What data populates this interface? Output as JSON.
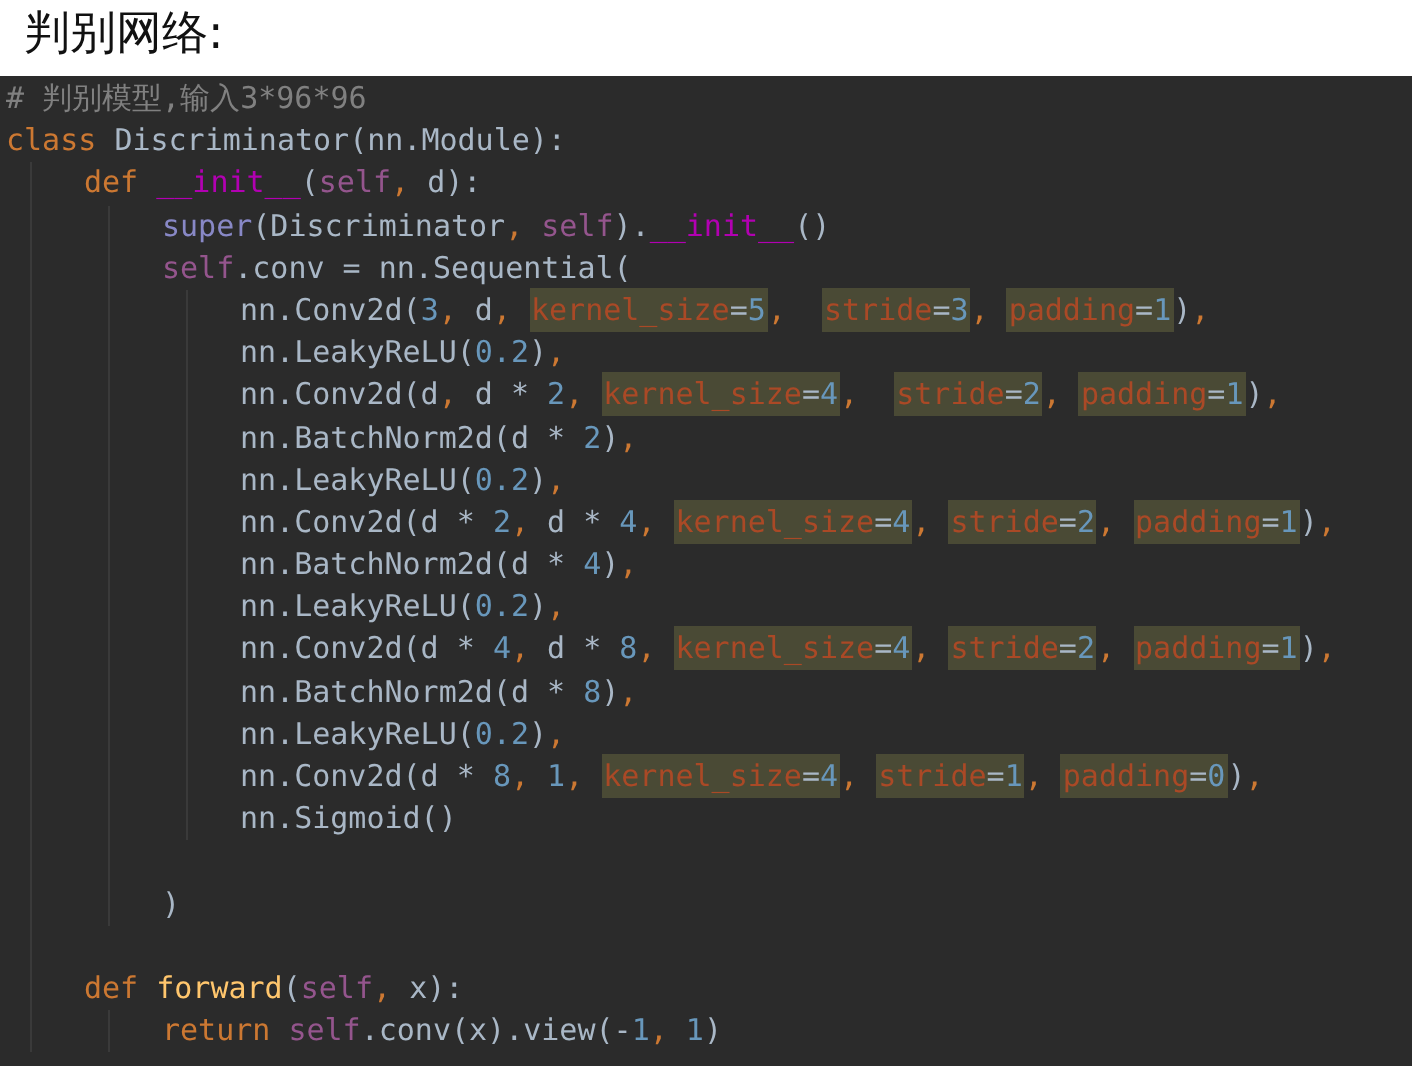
{
  "heading": "判别网络:",
  "code": [
    {
      "tokens": [
        {
          "kind": "cm",
          "t": "# 判别模型,输入3*96*96"
        }
      ]
    },
    {
      "tokens": [
        {
          "kind": "kw",
          "t": "class "
        },
        {
          "kind": "p",
          "t": "Discriminator(nn.Module):"
        }
      ],
      "children": [
        {
          "tokens": [
            {
              "kind": "kw",
              "t": "def "
            },
            {
              "kind": "dunder",
              "t": "__init__"
            },
            {
              "kind": "p",
              "t": "("
            },
            {
              "kind": "self",
              "t": "self"
            },
            {
              "kind": "kw",
              "t": ", "
            },
            {
              "kind": "p",
              "t": "d):"
            }
          ],
          "children": [
            {
              "tokens": [
                {
                  "kind": "builtin",
                  "t": "super"
                },
                {
                  "kind": "p",
                  "t": "(Discriminator"
                },
                {
                  "kind": "kw",
                  "t": ", "
                },
                {
                  "kind": "self",
                  "t": "self"
                },
                {
                  "kind": "p",
                  "t": ")."
                },
                {
                  "kind": "dunder",
                  "t": "__init__"
                },
                {
                  "kind": "p",
                  "t": "()"
                }
              ]
            },
            {
              "tokens": [
                {
                  "kind": "self",
                  "t": "self"
                },
                {
                  "kind": "p",
                  "t": ".conv = nn.Sequential("
                }
              ],
              "children": [
                {
                  "tokens": [
                    {
                      "kind": "p",
                      "t": "nn.Conv2d("
                    },
                    {
                      "kind": "num",
                      "t": "3"
                    },
                    {
                      "kind": "kw",
                      "t": ", "
                    },
                    {
                      "kind": "p",
                      "t": "d"
                    },
                    {
                      "kind": "kw",
                      "t": ", "
                    },
                    {
                      "kind": "hl",
                      "t": "kernel_size",
                      "eq": "=",
                      "v": "5"
                    },
                    {
                      "kind": "kw",
                      "t": ",  "
                    },
                    {
                      "kind": "hl",
                      "t": "stride",
                      "eq": "=",
                      "v": "3"
                    },
                    {
                      "kind": "kw",
                      "t": ", "
                    },
                    {
                      "kind": "hl",
                      "t": "padding",
                      "eq": "=",
                      "v": "1"
                    },
                    {
                      "kind": "p",
                      "t": ")"
                    },
                    {
                      "kind": "kw",
                      "t": ","
                    }
                  ]
                },
                {
                  "tokens": [
                    {
                      "kind": "p",
                      "t": "nn.LeakyReLU("
                    },
                    {
                      "kind": "num",
                      "t": "0.2"
                    },
                    {
                      "kind": "p",
                      "t": ")"
                    },
                    {
                      "kind": "kw",
                      "t": ","
                    }
                  ]
                },
                {
                  "tokens": [
                    {
                      "kind": "p",
                      "t": "nn.Conv2d(d"
                    },
                    {
                      "kind": "kw",
                      "t": ", "
                    },
                    {
                      "kind": "p",
                      "t": "d * "
                    },
                    {
                      "kind": "num",
                      "t": "2"
                    },
                    {
                      "kind": "kw",
                      "t": ", "
                    },
                    {
                      "kind": "hl",
                      "t": "kernel_size",
                      "eq": "=",
                      "v": "4"
                    },
                    {
                      "kind": "kw",
                      "t": ",  "
                    },
                    {
                      "kind": "hl",
                      "t": "stride",
                      "eq": "=",
                      "v": "2"
                    },
                    {
                      "kind": "kw",
                      "t": ", "
                    },
                    {
                      "kind": "hl",
                      "t": "padding",
                      "eq": "=",
                      "v": "1"
                    },
                    {
                      "kind": "p",
                      "t": ")"
                    },
                    {
                      "kind": "kw",
                      "t": ","
                    }
                  ]
                },
                {
                  "tokens": [
                    {
                      "kind": "p",
                      "t": "nn.BatchNorm2d(d * "
                    },
                    {
                      "kind": "num",
                      "t": "2"
                    },
                    {
                      "kind": "p",
                      "t": ")"
                    },
                    {
                      "kind": "kw",
                      "t": ","
                    }
                  ]
                },
                {
                  "tokens": [
                    {
                      "kind": "p",
                      "t": "nn.LeakyReLU("
                    },
                    {
                      "kind": "num",
                      "t": "0.2"
                    },
                    {
                      "kind": "p",
                      "t": ")"
                    },
                    {
                      "kind": "kw",
                      "t": ","
                    }
                  ]
                },
                {
                  "tokens": [
                    {
                      "kind": "p",
                      "t": "nn.Conv2d(d * "
                    },
                    {
                      "kind": "num",
                      "t": "2"
                    },
                    {
                      "kind": "kw",
                      "t": ", "
                    },
                    {
                      "kind": "p",
                      "t": "d * "
                    },
                    {
                      "kind": "num",
                      "t": "4"
                    },
                    {
                      "kind": "kw",
                      "t": ", "
                    },
                    {
                      "kind": "hl",
                      "t": "kernel_size",
                      "eq": "=",
                      "v": "4"
                    },
                    {
                      "kind": "kw",
                      "t": ", "
                    },
                    {
                      "kind": "hl",
                      "t": "stride",
                      "eq": "=",
                      "v": "2"
                    },
                    {
                      "kind": "kw",
                      "t": ", "
                    },
                    {
                      "kind": "hl",
                      "t": "padding",
                      "eq": "=",
                      "v": "1"
                    },
                    {
                      "kind": "p",
                      "t": ")"
                    },
                    {
                      "kind": "kw",
                      "t": ","
                    }
                  ]
                },
                {
                  "tokens": [
                    {
                      "kind": "p",
                      "t": "nn.BatchNorm2d(d * "
                    },
                    {
                      "kind": "num",
                      "t": "4"
                    },
                    {
                      "kind": "p",
                      "t": ")"
                    },
                    {
                      "kind": "kw",
                      "t": ","
                    }
                  ]
                },
                {
                  "tokens": [
                    {
                      "kind": "p",
                      "t": "nn.LeakyReLU("
                    },
                    {
                      "kind": "num",
                      "t": "0.2"
                    },
                    {
                      "kind": "p",
                      "t": ")"
                    },
                    {
                      "kind": "kw",
                      "t": ","
                    }
                  ]
                },
                {
                  "tokens": [
                    {
                      "kind": "p",
                      "t": "nn.Conv2d(d * "
                    },
                    {
                      "kind": "num",
                      "t": "4"
                    },
                    {
                      "kind": "kw",
                      "t": ", "
                    },
                    {
                      "kind": "p",
                      "t": "d * "
                    },
                    {
                      "kind": "num",
                      "t": "8"
                    },
                    {
                      "kind": "kw",
                      "t": ", "
                    },
                    {
                      "kind": "hl",
                      "t": "kernel_size",
                      "eq": "=",
                      "v": "4"
                    },
                    {
                      "kind": "kw",
                      "t": ", "
                    },
                    {
                      "kind": "hl",
                      "t": "stride",
                      "eq": "=",
                      "v": "2"
                    },
                    {
                      "kind": "kw",
                      "t": ", "
                    },
                    {
                      "kind": "hl",
                      "t": "padding",
                      "eq": "=",
                      "v": "1"
                    },
                    {
                      "kind": "p",
                      "t": ")"
                    },
                    {
                      "kind": "kw",
                      "t": ","
                    }
                  ]
                },
                {
                  "tokens": [
                    {
                      "kind": "p",
                      "t": "nn.BatchNorm2d(d * "
                    },
                    {
                      "kind": "num",
                      "t": "8"
                    },
                    {
                      "kind": "p",
                      "t": ")"
                    },
                    {
                      "kind": "kw",
                      "t": ","
                    }
                  ]
                },
                {
                  "tokens": [
                    {
                      "kind": "p",
                      "t": "nn.LeakyReLU("
                    },
                    {
                      "kind": "num",
                      "t": "0.2"
                    },
                    {
                      "kind": "p",
                      "t": ")"
                    },
                    {
                      "kind": "kw",
                      "t": ","
                    }
                  ]
                },
                {
                  "tokens": [
                    {
                      "kind": "p",
                      "t": "nn.Conv2d(d * "
                    },
                    {
                      "kind": "num",
                      "t": "8"
                    },
                    {
                      "kind": "kw",
                      "t": ", "
                    },
                    {
                      "kind": "num",
                      "t": "1"
                    },
                    {
                      "kind": "kw",
                      "t": ", "
                    },
                    {
                      "kind": "hl",
                      "t": "kernel_size",
                      "eq": "=",
                      "v": "4"
                    },
                    {
                      "kind": "kw",
                      "t": ", "
                    },
                    {
                      "kind": "hl",
                      "t": "stride",
                      "eq": "=",
                      "v": "1"
                    },
                    {
                      "kind": "kw",
                      "t": ", "
                    },
                    {
                      "kind": "hl",
                      "t": "padding",
                      "eq": "=",
                      "v": "0"
                    },
                    {
                      "kind": "p",
                      "t": ")"
                    },
                    {
                      "kind": "kw",
                      "t": ","
                    }
                  ]
                },
                {
                  "tokens": [
                    {
                      "kind": "p",
                      "t": "nn.Sigmoid()"
                    }
                  ]
                }
              ]
            },
            {
              "gap_before": true,
              "tokens": [
                {
                  "kind": "p",
                  "t": ")"
                }
              ]
            }
          ]
        },
        {
          "gap_before": true,
          "tokens": [
            {
              "kind": "kw",
              "t": "def "
            },
            {
              "kind": "fn",
              "t": "forward"
            },
            {
              "kind": "p",
              "t": "("
            },
            {
              "kind": "self",
              "t": "self"
            },
            {
              "kind": "kw",
              "t": ", "
            },
            {
              "kind": "p",
              "t": "x):"
            }
          ],
          "children": [
            {
              "tokens": [
                {
                  "kind": "kw",
                  "t": "return "
                },
                {
                  "kind": "self",
                  "t": "self"
                },
                {
                  "kind": "p",
                  "t": ".conv(x).view(-"
                },
                {
                  "kind": "num",
                  "t": "1"
                },
                {
                  "kind": "kw",
                  "t": ", "
                },
                {
                  "kind": "num",
                  "t": "1"
                },
                {
                  "kind": "p",
                  "t": ")"
                }
              ]
            }
          ]
        }
      ]
    }
  ]
}
